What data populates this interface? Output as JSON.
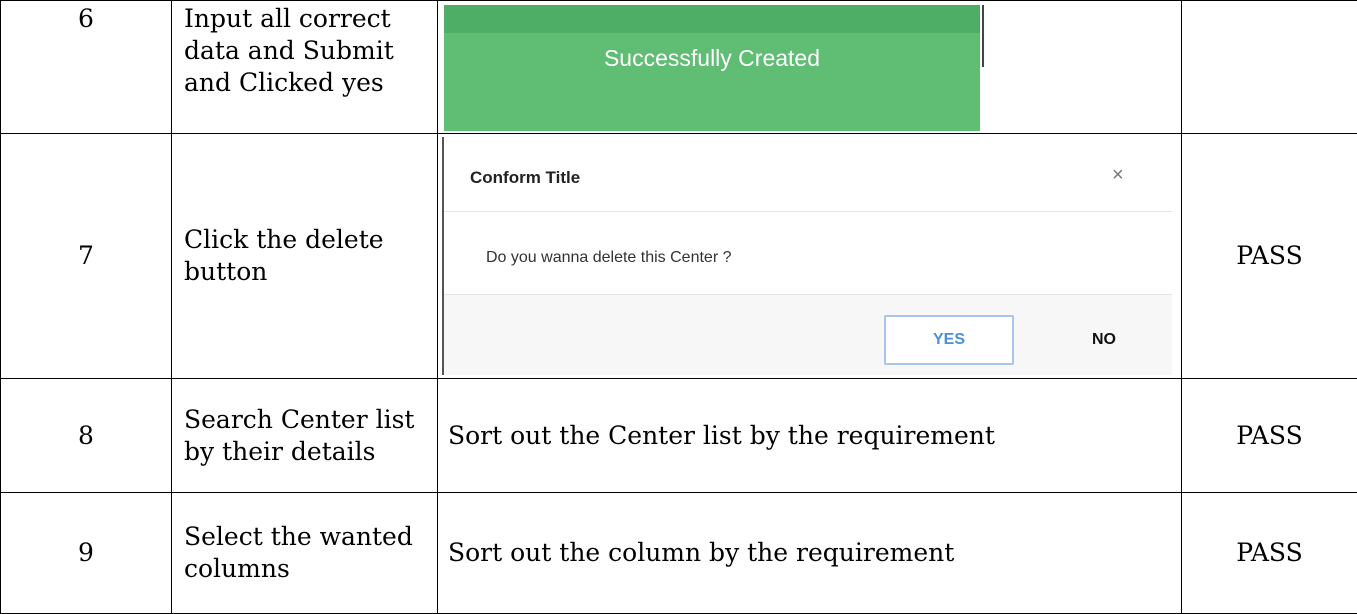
{
  "rows": [
    {
      "no": "6",
      "step": "Input all correct data and Submit and Clicked yes",
      "screenshot": {
        "toast_text": "Successfully Created",
        "toast_color": "#5fbd74"
      },
      "status": ""
    },
    {
      "no": "7",
      "step": "Click the delete button",
      "screenshot": {
        "modal_title": "Conform Title",
        "close_glyph": "×",
        "message": "Do you wanna delete this Center ?",
        "yes_label": "YES",
        "no_label": "NO",
        "yes_color": "#4a8fd8"
      },
      "status": "PASS"
    },
    {
      "no": "8",
      "step": "Search  Center list by their details",
      "result": "Sort out the  Center list by the requirement",
      "status": "PASS"
    },
    {
      "no": "9",
      "step": "Select the wanted columns",
      "result": "Sort out the column by the requirement",
      "status": "PASS"
    }
  ]
}
